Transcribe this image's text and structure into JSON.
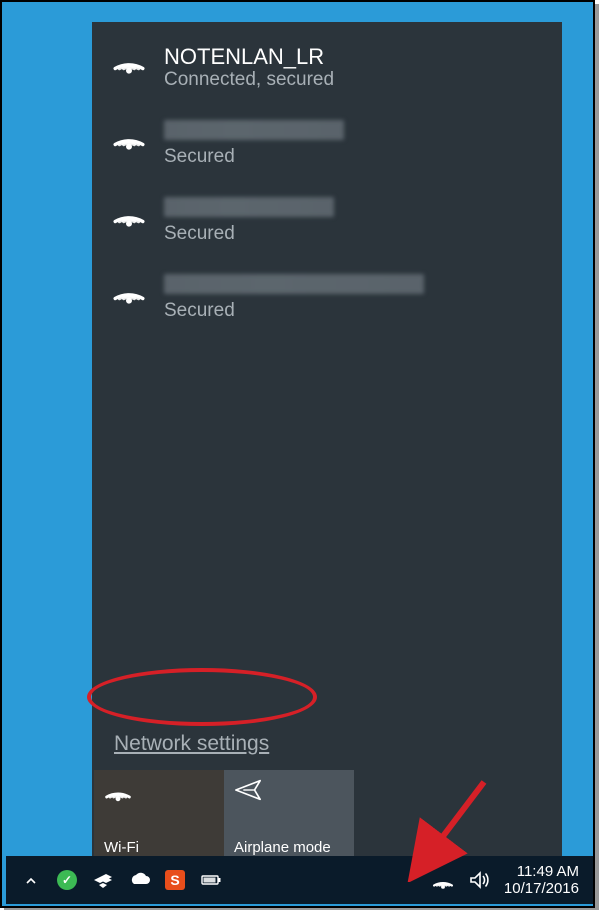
{
  "networks": [
    {
      "ssid": "NOTENLAN_LR",
      "status": "Connected, secured",
      "blurred": false
    },
    {
      "ssid": "",
      "status": "Secured",
      "blurred": true,
      "blurWidth": 180
    },
    {
      "ssid": "",
      "status": "Secured",
      "blurred": true,
      "blurWidth": 170
    },
    {
      "ssid": "",
      "status": "Secured",
      "blurred": true,
      "blurWidth": 260
    }
  ],
  "settings_link": "Network settings",
  "tiles": {
    "wifi": "Wi-Fi",
    "airplane": "Airplane mode"
  },
  "taskbar": {
    "time": "11:49 AM",
    "date": "10/17/2016"
  }
}
